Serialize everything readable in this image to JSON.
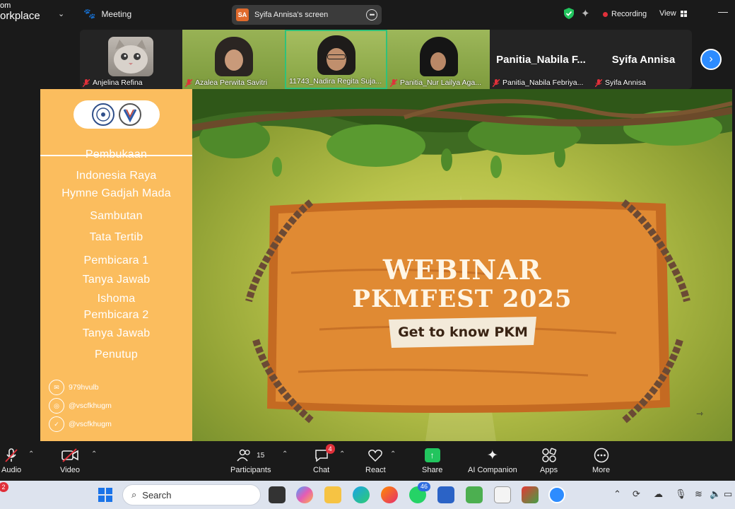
{
  "topbar": {
    "brand_small": "om",
    "brand_big": "orkplace",
    "meeting_label": "Meeting",
    "share_badge": "SA",
    "share_title": "Syifa Annisa's screen",
    "recording_label": "Recording",
    "view_label": "View"
  },
  "participants": [
    {
      "name": "Anjelina Refina"
    },
    {
      "name": "Azalea Perwita Savitri"
    },
    {
      "name": "11743_Nadira Regita Suja..."
    },
    {
      "name": "Panitia_Nur Lailya Aga..."
    },
    {
      "name": "Panitia_Nabila Febriya...",
      "display": "Panitia_Nabila  F..."
    },
    {
      "name": "Syifa Annisa",
      "display": "Syifa Annisa"
    }
  ],
  "slide": {
    "agenda": [
      "Pembukaan",
      "Indonesia Raya",
      "Hymne Gadjah Mada",
      "Sambutan",
      "Tata Tertib",
      "Pembicara 1",
      "Tanya Jawab",
      "Ishoma",
      "Pembicara 2",
      "Tanya Jawab",
      "Penutup"
    ],
    "socials": [
      {
        "icon": "line-icon",
        "handle": "979hvulb"
      },
      {
        "icon": "instagram-icon",
        "handle": "@vscfkhugm"
      },
      {
        "icon": "twitter-icon",
        "handle": "@vscfkhugm"
      }
    ],
    "title_line1": "WEBINAR",
    "title_line2": "PKMFEST 2025",
    "tagline": "Get to know PKM"
  },
  "toolbar": {
    "audio": "Audio",
    "video": "Video",
    "participants": "Participants",
    "participants_count": "15",
    "chat": "Chat",
    "chat_badge": "4",
    "react": "React",
    "share": "Share",
    "ai": "AI Companion",
    "apps": "Apps",
    "more": "More"
  },
  "taskbar": {
    "search_placeholder": "Search",
    "notif_count": "2",
    "whatsapp_badge": "46"
  },
  "colors": {
    "agenda_bg": "#fbbd5e",
    "accent_blue": "#2d8cff",
    "recording_red": "#e0303a",
    "active_green": "#2fc27a"
  }
}
